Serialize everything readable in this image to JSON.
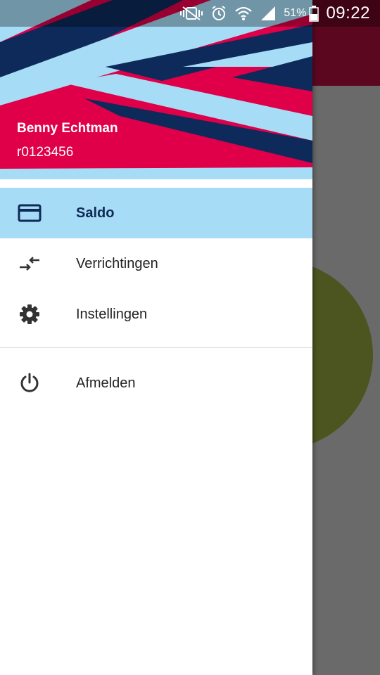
{
  "status_bar": {
    "battery_percent": "51%",
    "time": "09:22",
    "icons": [
      "vibrate-mute-icon",
      "alarm-icon",
      "wifi-icon",
      "signal-icon",
      "battery-icon"
    ]
  },
  "colors": {
    "header_red": "#e0004a",
    "header_navy": "#0d2a5a",
    "header_lightblue": "#a6dcf5",
    "active_item_bg": "#a6dcf5",
    "active_item_text": "#0f2a57",
    "scrim": "#666666"
  },
  "drawer": {
    "user": {
      "name": "Benny Echtman",
      "id": "r0123456"
    },
    "menu": [
      {
        "label": "Saldo",
        "icon": "credit-card-icon",
        "active": true
      },
      {
        "label": "Verrichtingen",
        "icon": "transactions-icon",
        "active": false
      },
      {
        "label": "Instellingen",
        "icon": "gear-icon",
        "active": false
      }
    ],
    "footer_menu": [
      {
        "label": "Afmelden",
        "icon": "power-icon",
        "active": false
      }
    ]
  }
}
